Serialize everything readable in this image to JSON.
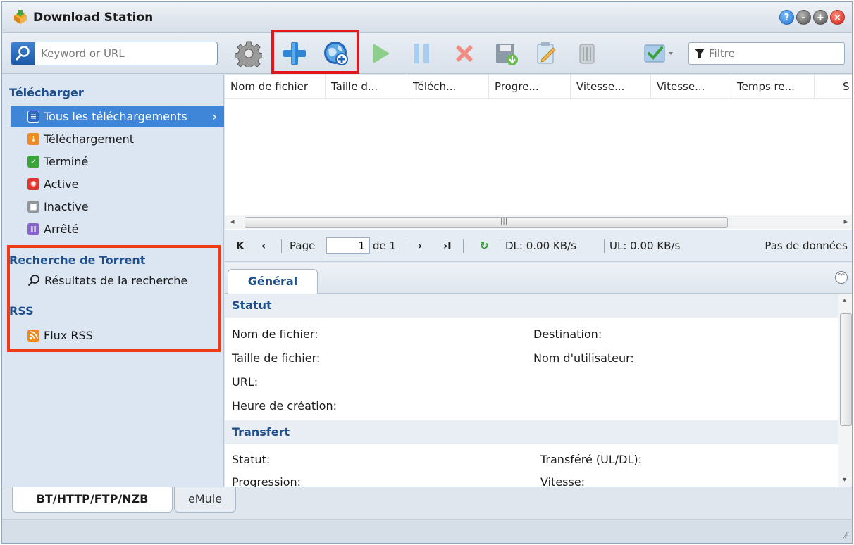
{
  "window": {
    "title": "Download Station"
  },
  "toolbar": {
    "search_placeholder": "Keyword or URL",
    "filter_placeholder": "Filtre"
  },
  "sidebar": {
    "sections": [
      {
        "title": "Télécharger"
      },
      {
        "title": "Recherche de Torrent"
      },
      {
        "title": "RSS"
      }
    ],
    "items": [
      {
        "label": "Tous les téléchargements"
      },
      {
        "label": "Téléchargement"
      },
      {
        "label": "Terminé"
      },
      {
        "label": "Active"
      },
      {
        "label": "Inactive"
      },
      {
        "label": "Arrêté"
      },
      {
        "label": "Résultats de la recherche"
      },
      {
        "label": "Flux RSS"
      }
    ]
  },
  "grid": {
    "columns": [
      "Nom de fichier",
      "Taille d...",
      "Téléch...",
      "Progre...",
      "Vitesse...",
      "Vitesse...",
      "Temps re...",
      "S"
    ]
  },
  "pager": {
    "page_label": "Page",
    "page_value": "1",
    "of_label": "de 1",
    "dl": "DL: 0.00 KB/s",
    "ul": "UL: 0.00 KB/s",
    "empty": "Pas de données"
  },
  "detail": {
    "tab": "Général",
    "groups": [
      {
        "title": "Statut"
      },
      {
        "title": "Transfert"
      }
    ],
    "fields": {
      "filename": "Nom de fichier:",
      "destination": "Destination:",
      "filesize": "Taille de fichier:",
      "username": "Nom d'utilisateur:",
      "url": "URL:",
      "created": "Heure de création:",
      "status": "Statut:",
      "transferred": "Transféré (UL/DL):",
      "progress": "Progression:",
      "speed": "Vitesse:"
    }
  },
  "bottom_tabs": [
    "BT/HTTP/FTP/NZB",
    "eMule"
  ],
  "colors": {
    "accent": "#3f85d8",
    "highlight": "#e8141b",
    "section": "#1f4e8c"
  }
}
